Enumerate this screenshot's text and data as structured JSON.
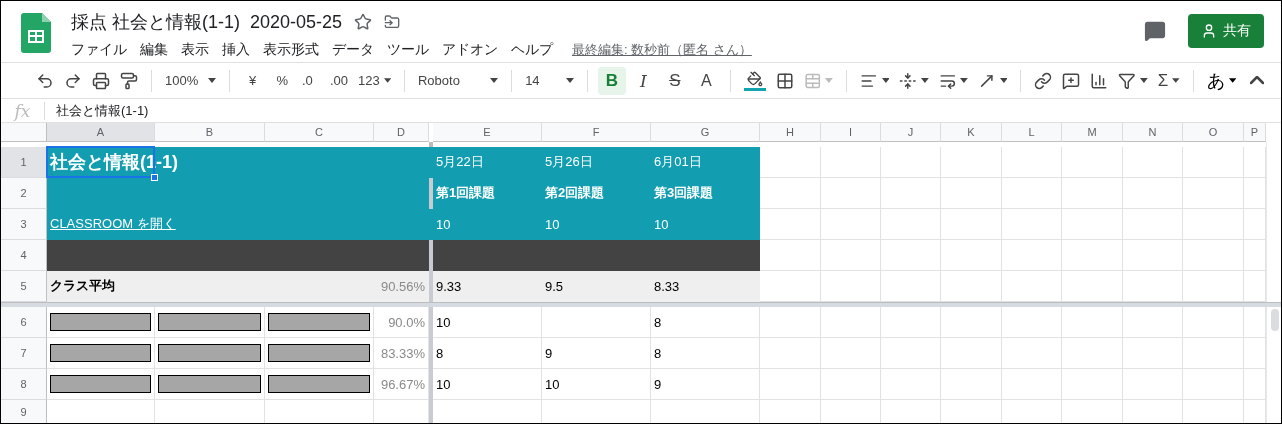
{
  "document": {
    "title": "採点 社会と情報(1-1)  2020-05-25"
  },
  "menu": [
    "ファイル",
    "編集",
    "表示",
    "挿入",
    "表示形式",
    "データ",
    "ツール",
    "アドオン",
    "ヘルプ"
  ],
  "last_edit": "最終編集: 数秒前（匿名 さん）",
  "share_button": "共有",
  "toolbar": {
    "zoom": "100%",
    "currency": "¥",
    "percent": "%",
    "decrease_decimals": ".0",
    "increase_decimals": ".00",
    "number_format": "123",
    "font": "Roboto",
    "font_size": "14",
    "format": [
      {
        "kind": "bold",
        "text": "B",
        "selected": true
      },
      {
        "kind": "italic",
        "text": "I",
        "selected": false
      },
      {
        "kind": "strikethrough",
        "text": "S",
        "selected": false
      },
      {
        "kind": "text_color",
        "text": "A",
        "selected": false
      }
    ],
    "merge_cells": {
      "disabled": true
    },
    "functions": "Σ",
    "input_tools": "あ"
  },
  "formula_bar": {
    "label": "fx",
    "value": "社会と情報(1-1)"
  },
  "grid": {
    "columns": [
      {
        "label": "A",
        "selected": true
      },
      {
        "label": "B",
        "selected": false
      },
      {
        "label": "C",
        "selected": false
      },
      {
        "label": "D",
        "selected": false
      },
      {
        "label": "E",
        "selected": false
      },
      {
        "label": "F",
        "selected": false
      },
      {
        "label": "G",
        "selected": false
      },
      {
        "label": "H",
        "selected": false
      },
      {
        "label": "I",
        "selected": false
      },
      {
        "label": "J",
        "selected": false
      },
      {
        "label": "K",
        "selected": false
      },
      {
        "label": "L",
        "selected": false
      },
      {
        "label": "M",
        "selected": false
      },
      {
        "label": "N",
        "selected": false
      },
      {
        "label": "O",
        "selected": false
      },
      {
        "label": "P",
        "selected": false
      }
    ],
    "rows": [
      {
        "label": "1",
        "selected": true,
        "kind": "title",
        "cells": [
          {
            "kind": "heading",
            "text": "社会と情報(1-1)"
          },
          null,
          null,
          null,
          {
            "kind": "text",
            "text": "5月22日"
          },
          {
            "kind": "text",
            "text": "5月26日"
          },
          {
            "kind": "text",
            "text": "6月01日"
          }
        ]
      },
      {
        "label": "2",
        "selected": false,
        "kind": "title",
        "cells": [
          null,
          null,
          null,
          null,
          {
            "kind": "label",
            "text": "第1回課題"
          },
          {
            "kind": "label",
            "text": "第2回課題"
          },
          {
            "kind": "label",
            "text": "第3回課題"
          }
        ]
      },
      {
        "label": "3",
        "selected": false,
        "kind": "title",
        "cells": [
          {
            "kind": "link",
            "text": "CLASSROOM を開く"
          },
          null,
          null,
          null,
          {
            "kind": "text",
            "text": "10"
          },
          {
            "kind": "text",
            "text": "10"
          },
          {
            "kind": "text",
            "text": "10"
          }
        ]
      },
      {
        "label": "4",
        "selected": false,
        "kind": "dark"
      },
      {
        "label": "5",
        "selected": false,
        "kind": "average",
        "cells": [
          {
            "kind": "label",
            "text": "クラス平均"
          },
          null,
          null,
          {
            "kind": "text",
            "text": "90.56%"
          },
          {
            "kind": "text",
            "text": "9.33"
          },
          {
            "kind": "text",
            "text": "9.5"
          },
          {
            "kind": "text",
            "text": "8.33"
          }
        ]
      },
      {
        "label": "6",
        "selected": false,
        "kind": "plain",
        "cells": [
          {
            "kind": "redacted"
          },
          {
            "kind": "redacted"
          },
          {
            "kind": "redacted"
          },
          {
            "kind": "text",
            "text": "90.0%"
          },
          {
            "kind": "text",
            "text": "10"
          },
          null,
          {
            "kind": "text",
            "text": "8"
          }
        ]
      },
      {
        "label": "7",
        "selected": false,
        "kind": "plain",
        "cells": [
          {
            "kind": "redacted"
          },
          {
            "kind": "redacted"
          },
          {
            "kind": "redacted"
          },
          {
            "kind": "text",
            "text": "83.33%"
          },
          {
            "kind": "text",
            "text": "8"
          },
          {
            "kind": "text",
            "text": "9"
          },
          {
            "kind": "text",
            "text": "8"
          }
        ]
      },
      {
        "label": "8",
        "selected": false,
        "kind": "plain",
        "cells": [
          {
            "kind": "redacted"
          },
          {
            "kind": "redacted"
          },
          {
            "kind": "redacted"
          },
          {
            "kind": "text",
            "text": "96.67%"
          },
          {
            "kind": "text",
            "text": "10"
          },
          {
            "kind": "text",
            "text": "10"
          },
          {
            "kind": "text",
            "text": "9"
          }
        ]
      },
      {
        "label": "9",
        "selected": false,
        "kind": "plain"
      }
    ]
  }
}
